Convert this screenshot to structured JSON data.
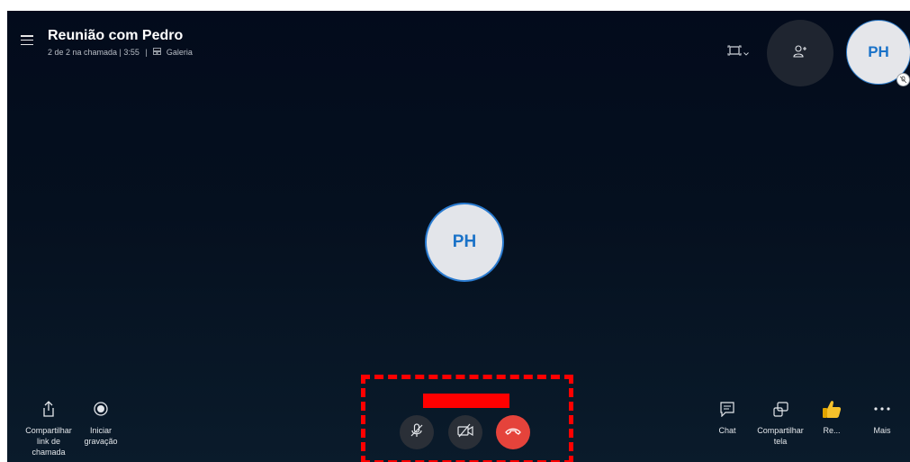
{
  "header": {
    "title": "Reunião com Pedro",
    "call_status": "2 de 2 na chamada | 3:55",
    "separator": "|",
    "view_mode": "Galeria"
  },
  "participants": {
    "main_initials": "PH",
    "self_initials": "PH"
  },
  "toolbar_left": {
    "share_link_label": "Compartilhar link de chamada",
    "record_label": "Iniciar gravação"
  },
  "toolbar_right": {
    "chat_label": "Chat",
    "share_screen_label": "Compartilhar tela",
    "react_label": "Re...",
    "more_label": "Mais"
  },
  "colors": {
    "background": "#030b1c",
    "avatar_bg": "#e3e5ea",
    "avatar_text": "#1a72c8",
    "hangup": "#e5433b",
    "annotation": "#ff0000"
  },
  "icons": {
    "menu": "hamburger-icon",
    "layout": "screen-layout-icon",
    "add_people": "add-person-icon",
    "mic_muted": "mic-off-icon",
    "video_off": "video-off-icon",
    "hangup": "phone-hangup-icon",
    "share_link": "share-icon",
    "record": "record-icon",
    "chat": "chat-icon",
    "share_screen": "share-screen-icon",
    "react": "thumbs-up-icon",
    "more": "more-icon"
  }
}
